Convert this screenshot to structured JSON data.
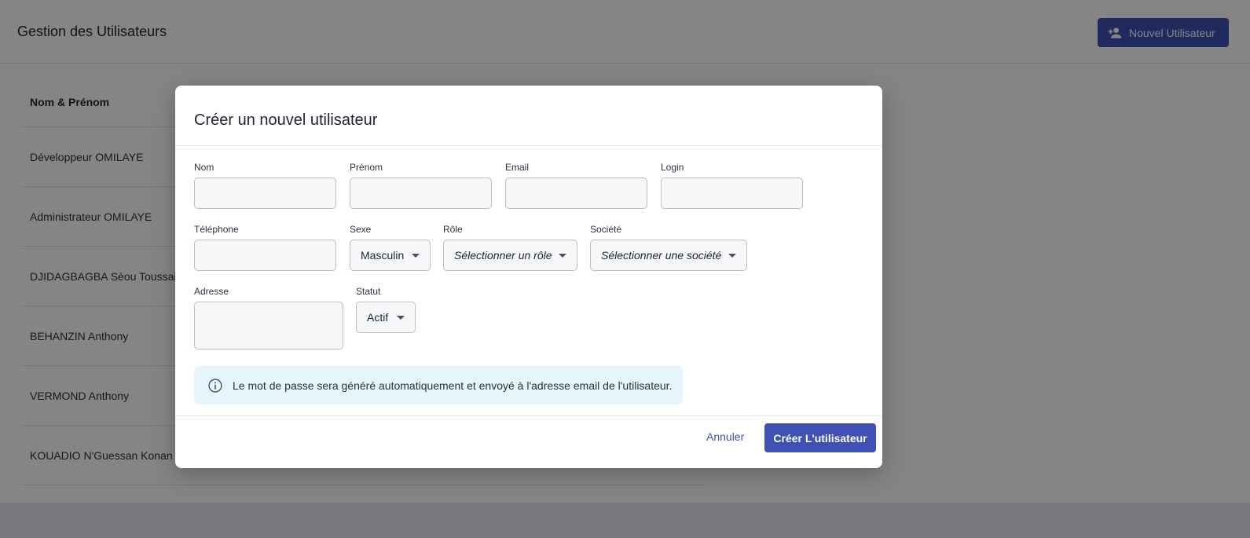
{
  "page": {
    "title": "Gestion des Utilisateurs",
    "new_user_label": "Nouvel Utilisateur"
  },
  "table": {
    "header": "Nom & Prénom",
    "rows": [
      "Développeur OMILAYE",
      "Administrateur OMILAYE",
      "DJIDAGBAGBA Sèou Toussaint",
      "BEHANZIN Anthony",
      "VERMOND Anthony",
      "KOUADIO N'Guessan Konan"
    ]
  },
  "modal": {
    "title": "Créer un nouvel utilisateur",
    "fields": {
      "nom": {
        "label": "Nom",
        "value": ""
      },
      "prenom": {
        "label": "Prénom",
        "value": ""
      },
      "email": {
        "label": "Email",
        "value": ""
      },
      "login": {
        "label": "Login",
        "value": ""
      },
      "telephone": {
        "label": "Téléphone",
        "value": ""
      },
      "sexe": {
        "label": "Sexe",
        "value": "Masculin"
      },
      "role": {
        "label": "Rôle",
        "placeholder": "Sélectionner un rôle"
      },
      "societe": {
        "label": "Société",
        "placeholder": "Sélectionner une société"
      },
      "adresse": {
        "label": "Adresse",
        "value": ""
      },
      "statut": {
        "label": "Statut",
        "value": "Actif"
      }
    },
    "info_message": "Le mot de passe sera généré automatiquement et envoyé à l'adresse email de l'utilisateur.",
    "cancel_label": "Annuler",
    "submit_label": "Créer L'utilisateur"
  },
  "icons": {
    "new_user": "person-add-icon",
    "info": "info-circle-icon",
    "dropdown": "caret-down-icon"
  },
  "colors": {
    "primary": "#3f51b5",
    "info_bg": "#e6f4fb"
  }
}
